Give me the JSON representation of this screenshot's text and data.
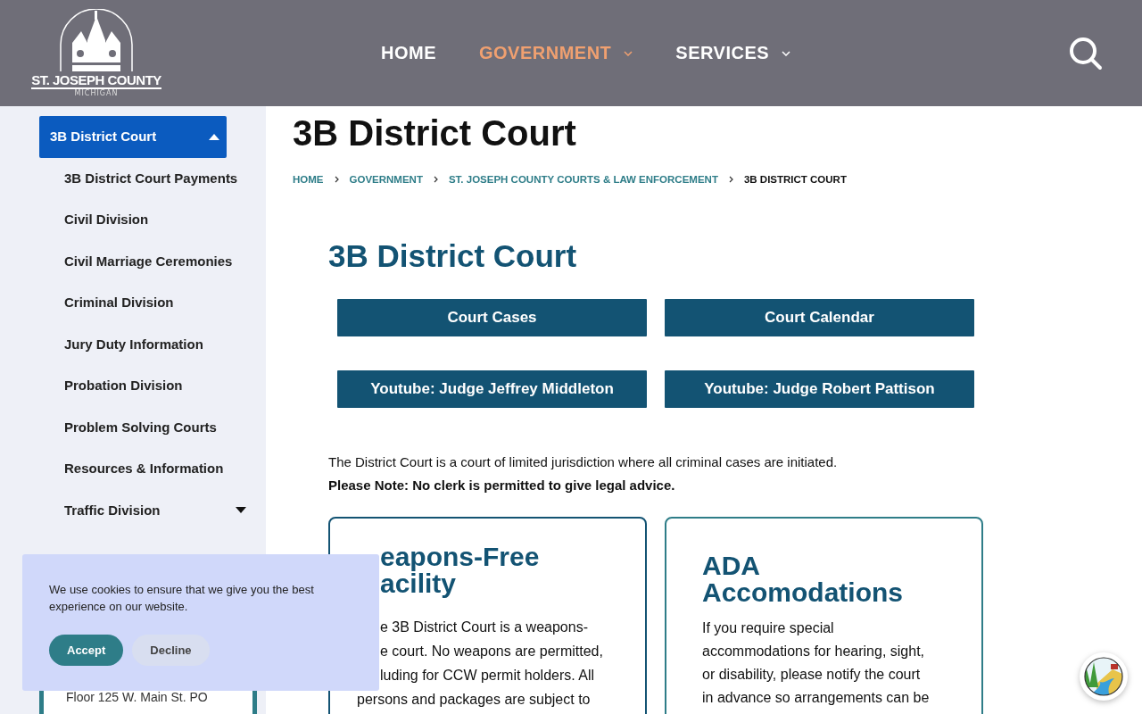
{
  "header": {
    "logo": {
      "name": "ST. JOSEPH COUNTY",
      "sub": "MICHIGAN"
    },
    "nav": [
      {
        "label": "HOME",
        "selected": false,
        "dropdown": false
      },
      {
        "label": "GOVERNMENT",
        "selected": true,
        "dropdown": true
      },
      {
        "label": "SERVICES",
        "selected": false,
        "dropdown": true
      }
    ]
  },
  "sidebar": {
    "items": [
      {
        "label": "3B District Court",
        "selected": true,
        "expanded": true,
        "has_children": true
      },
      {
        "label": "3B District Court Payments",
        "selected": false,
        "has_children": false
      },
      {
        "label": "Civil Division",
        "selected": false,
        "has_children": false
      },
      {
        "label": "Civil Marriage Ceremonies",
        "selected": false,
        "has_children": false
      },
      {
        "label": "Criminal Division",
        "selected": false,
        "has_children": false
      },
      {
        "label": "Jury Duty Information",
        "selected": false,
        "has_children": false
      },
      {
        "label": "Probation Division",
        "selected": false,
        "has_children": false
      },
      {
        "label": "Problem Solving Courts",
        "selected": false,
        "has_children": false
      },
      {
        "label": "Resources & Information",
        "selected": false,
        "has_children": false
      },
      {
        "label": "Traffic Division",
        "selected": false,
        "expanded": false,
        "has_children": true
      }
    ],
    "contact_lines": [
      "Floor 125 W. Main St. PO"
    ]
  },
  "page_title": "3B District Court",
  "breadcrumb": [
    {
      "label": "HOME",
      "current": false
    },
    {
      "label": "GOVERNMENT",
      "current": false
    },
    {
      "label": "ST. JOSEPH COUNTY COURTS & LAW ENFORCEMENT",
      "current": false
    },
    {
      "label": "3B DISTRICT COURT",
      "current": true
    }
  ],
  "section_title": "3B District Court",
  "buttons": [
    "Court Cases",
    "Court Calendar",
    "Youtube: Judge Jeffrey Middleton",
    "Youtube: Judge Robert Pattison"
  ],
  "intro": "The District Court is a court of limited jurisdiction where all criminal cases are initiated.",
  "note": "Please Note: No clerk is permitted to give legal advice.",
  "cards": [
    {
      "title_lines": [
        {
          "text": "eapons-Free",
          "cut": true
        },
        {
          "text": "acility",
          "cut": true
        }
      ],
      "lines": [
        {
          "text": "e 3B District Court is a weapons-",
          "cut": true
        },
        {
          "text": "e court. No weapons are permitted,",
          "cut": true
        },
        {
          "text": "luding for CCW permit holders. All",
          "cut": true
        },
        {
          "text": "persons and packages are subject to",
          "cut": false
        }
      ]
    },
    {
      "title_lines": [
        {
          "text": "ADA",
          "cut": false
        },
        {
          "text": "Accomodations",
          "cut": false
        }
      ],
      "lines": [
        {
          "text": "If you require special",
          "cut": false
        },
        {
          "text": "accommodations for hearing, sight,",
          "cut": false
        },
        {
          "text": "or disability, please notify the court",
          "cut": false
        },
        {
          "text": "in advance so arrangements can be",
          "cut": false
        }
      ]
    }
  ],
  "cookie": {
    "text": "We use cookies to ensure that we give you the best experience on our website.",
    "accept": "Accept",
    "decline": "Decline"
  }
}
